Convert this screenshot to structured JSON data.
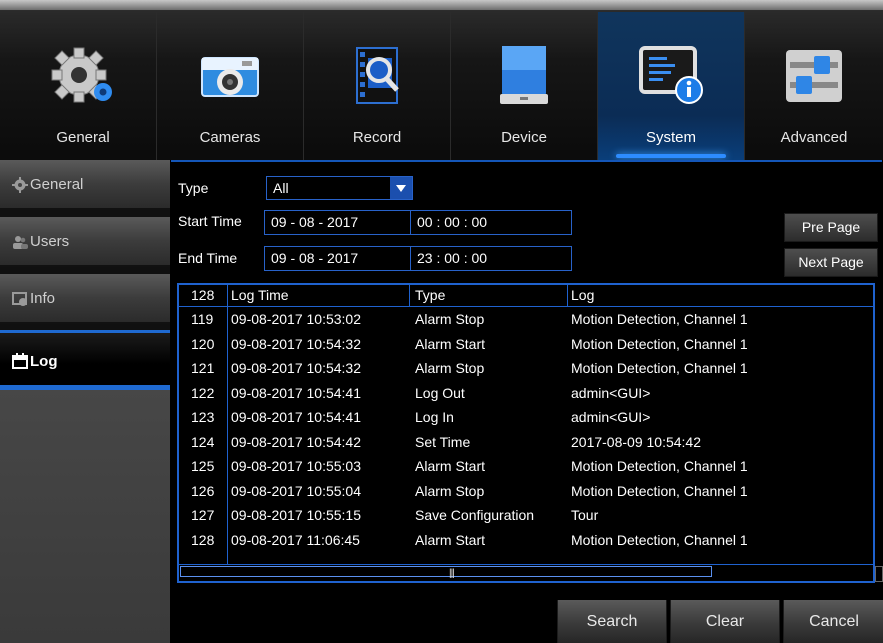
{
  "nav": {
    "tabs": [
      {
        "label": "General",
        "icon": "gear-icon"
      },
      {
        "label": "Cameras",
        "icon": "camera-icon"
      },
      {
        "label": "Record",
        "icon": "record-icon"
      },
      {
        "label": "Device",
        "icon": "hard-drive-icon"
      },
      {
        "label": "System",
        "icon": "system-info-icon",
        "active": true
      },
      {
        "label": "Advanced",
        "icon": "sliders-icon"
      }
    ]
  },
  "sidebar": {
    "items": [
      {
        "label": "General",
        "icon": "gear-icon"
      },
      {
        "label": "Users",
        "icon": "users-icon"
      },
      {
        "label": "Info",
        "icon": "info-icon"
      },
      {
        "label": "Log",
        "icon": "calendar-icon",
        "active": true
      }
    ]
  },
  "filters": {
    "type_label": "Type",
    "type_value": "All",
    "start_label": "Start Time",
    "start_date": "09 - 08 - 2017",
    "start_time": "00 : 00 : 00",
    "end_label": "End Time",
    "end_date": "09 - 08 - 2017",
    "end_time": "23 : 00 : 00"
  },
  "paging": {
    "prev_label": "Pre Page",
    "next_label": "Next Page"
  },
  "table": {
    "count": "128",
    "headers": {
      "time": "Log Time",
      "type": "Type",
      "log": "Log"
    },
    "rows": [
      {
        "no": "119",
        "time": "09-08-2017 10:53:02",
        "type": "Alarm Stop",
        "log": "Motion Detection, Channel 1"
      },
      {
        "no": "120",
        "time": "09-08-2017 10:54:32",
        "type": "Alarm Start",
        "log": "Motion Detection, Channel 1"
      },
      {
        "no": "121",
        "time": "09-08-2017 10:54:32",
        "type": "Alarm Stop",
        "log": "Motion Detection, Channel 1"
      },
      {
        "no": "122",
        "time": "09-08-2017 10:54:41",
        "type": "Log Out",
        "log": "admin<GUI>"
      },
      {
        "no": "123",
        "time": "09-08-2017 10:54:41",
        "type": "Log In",
        "log": "admin<GUI>"
      },
      {
        "no": "124",
        "time": "09-08-2017 10:54:42",
        "type": "Set Time",
        "log": "2017-08-09 10:54:42"
      },
      {
        "no": "125",
        "time": "09-08-2017 10:55:03",
        "type": "Alarm Start",
        "log": "Motion Detection, Channel 1"
      },
      {
        "no": "126",
        "time": "09-08-2017 10:55:04",
        "type": "Alarm Stop",
        "log": "Motion Detection, Channel 1"
      },
      {
        "no": "127",
        "time": "09-08-2017 10:55:15",
        "type": "Save Configuration",
        "log": "Tour"
      },
      {
        "no": "128",
        "time": "09-08-2017 11:06:45",
        "type": "Alarm Start",
        "log": "Motion Detection, Channel 1"
      }
    ]
  },
  "actions": {
    "search_label": "Search",
    "clear_label": "Clear",
    "cancel_label": "Cancel"
  },
  "colors": {
    "accent": "#1f62cf",
    "active_tab": "#0b2c55"
  }
}
